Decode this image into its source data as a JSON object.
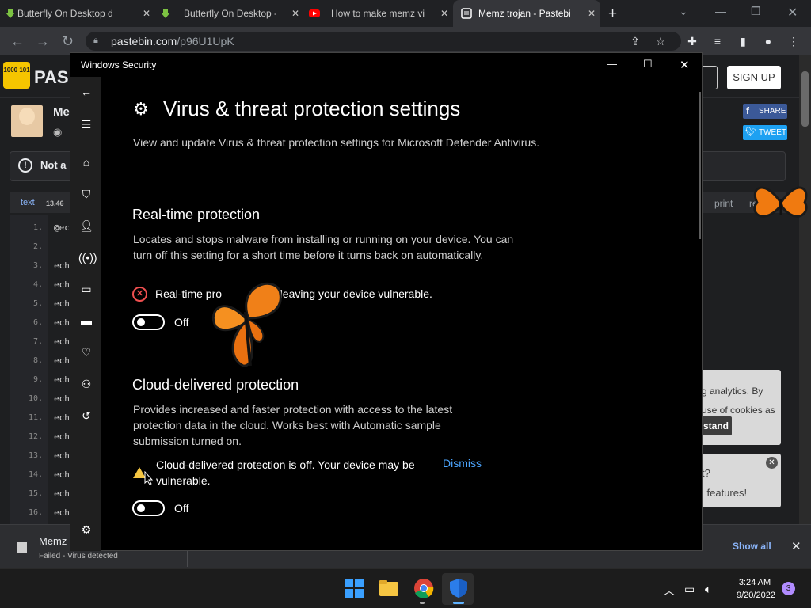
{
  "browser": {
    "tabs": [
      {
        "title": "Butterfly On Desktop d",
        "icon": "download-arrow-icon"
      },
      {
        "title": "Butterfly On Desktop -",
        "icon": "download-arrow-icon"
      },
      {
        "title": "How to make memz vi",
        "icon": "youtube-icon"
      },
      {
        "title": "Memz trojan - Pastebi",
        "icon": "pastebin-icon"
      }
    ],
    "new_tab": "+",
    "url_host": "pastebin.com",
    "url_path": "/p96U1UpK"
  },
  "pastebin": {
    "logo_text": "PAS",
    "logo_badge": "1000 101",
    "paste_title": "Me",
    "signup": "SIGN UP",
    "share": "SHARE",
    "tweet": "TWEET",
    "notice": "Not a",
    "code_type": "text",
    "code_size": "13.46",
    "print": "print",
    "report": "repo",
    "lines": [
      {
        "n": "1.",
        "code": "@ec"
      },
      {
        "n": "2.",
        "code": ""
      },
      {
        "n": "3.",
        "code": "ech"
      },
      {
        "n": "4.",
        "code": "ech"
      },
      {
        "n": "5.",
        "code": "ech"
      },
      {
        "n": "6.",
        "code": "ech"
      },
      {
        "n": "7.",
        "code": "ech"
      },
      {
        "n": "8.",
        "code": "ech"
      },
      {
        "n": "9.",
        "code": "ech"
      },
      {
        "n": "10.",
        "code": "ech"
      },
      {
        "n": "11.",
        "code": "ech"
      },
      {
        "n": "12.",
        "code": "ech"
      },
      {
        "n": "13.",
        "code": "ech"
      },
      {
        "n": "14.",
        "code": "ech"
      },
      {
        "n": "15.",
        "code": "ech"
      },
      {
        "n": "16.",
        "code": "ech"
      }
    ],
    "cookie_lines": [
      "g analytics. By",
      "use of cookies as"
    ],
    "cookie_button": "stand",
    "promo_lines": [
      "t?",
      "l features!"
    ]
  },
  "download": {
    "name": "Memz",
    "status": "Failed - Virus detected",
    "show_all": "Show all"
  },
  "taskbar": {
    "time": "3:24 AM",
    "date": "9/20/2022",
    "notifications": "3"
  },
  "security": {
    "window_title": "Windows Security",
    "heading": "Virus & threat protection settings",
    "intro": "View and update Virus & threat protection settings for Microsoft Defender Antivirus.",
    "realtime": {
      "title": "Real-time protection",
      "desc": "Locates and stops malware from installing or running on your device. You can turn off this setting for a short time before it turns back on automatically.",
      "warning": "Real-time pro             off, leaving your device vulnerable.",
      "toggle_label": "Off"
    },
    "cloud": {
      "title": "Cloud-delivered protection",
      "desc": "Provides increased and faster protection with access to the latest protection data in the cloud. Works best with Automatic sample submission turned on.",
      "warning": "Cloud-delivered protection is off. Your device may be vulnerable.",
      "dismiss": "Dismiss",
      "toggle_label": "Off"
    }
  }
}
